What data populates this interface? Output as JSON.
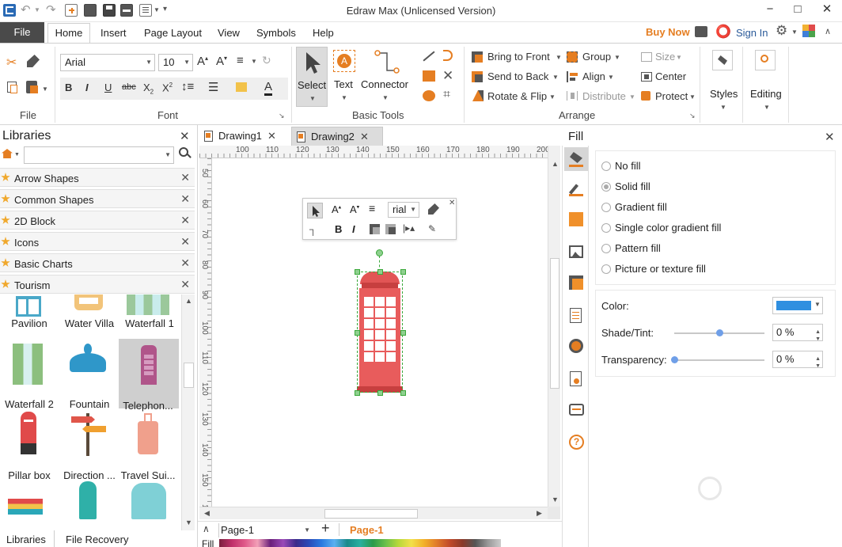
{
  "titlebar": {
    "title": "Edraw Max (Unlicensed Version)",
    "minimize": "−",
    "maximize": "□",
    "close": "✕"
  },
  "menu": {
    "file": "File",
    "tabs": [
      "Home",
      "Insert",
      "Page Layout",
      "View",
      "Symbols",
      "Help"
    ],
    "buy_now": "Buy Now",
    "sign_in": "Sign In"
  },
  "ribbon": {
    "file_group": "File",
    "font_group": "Font",
    "font_name": "Arial",
    "font_size": "10",
    "basic_tools_group": "Basic Tools",
    "select": "Select",
    "text": "Text",
    "connector": "Connector",
    "arrange_group": "Arrange",
    "bring_to_front": "Bring to Front",
    "send_to_back": "Send to Back",
    "rotate_flip": "Rotate & Flip",
    "group": "Group",
    "align": "Align",
    "distribute": "Distribute",
    "size": "Size",
    "center": "Center",
    "protect": "Protect",
    "styles": "Styles",
    "editing": "Editing"
  },
  "libraries": {
    "title": "Libraries",
    "search_placeholder": "",
    "categories": [
      "Arrow Shapes",
      "Common Shapes",
      "2D Block",
      "Icons",
      "Basic Charts",
      "Tourism"
    ],
    "shapes": [
      "Pavilion",
      "Water Villa",
      "Waterfall 1",
      "Waterfall 2",
      "Fountain",
      "Telephon...",
      "Pillar box",
      "Direction ...",
      "Travel Sui..."
    ],
    "bottom_tabs": [
      "Libraries",
      "File Recovery"
    ]
  },
  "documents": {
    "tabs": [
      "Drawing1",
      "Drawing2"
    ]
  },
  "ruler": {
    "top": [
      "100",
      "110",
      "120",
      "130",
      "140",
      "150",
      "160",
      "170",
      "180",
      "190",
      "200"
    ],
    "left": [
      "50",
      "60",
      "70",
      "80",
      "90",
      "100",
      "110",
      "120",
      "130",
      "140",
      "150",
      "160"
    ]
  },
  "floating_toolbar": {
    "font": "rial"
  },
  "statusbar": {
    "page_select": "Page-1",
    "page_tab": "Page-1",
    "fill_label": "Fill"
  },
  "fill_panel": {
    "title": "Fill",
    "options": [
      "No fill",
      "Solid fill",
      "Gradient fill",
      "Single color gradient fill",
      "Pattern fill",
      "Picture or texture fill"
    ],
    "selected_option": "Solid fill",
    "color_label": "Color:",
    "color_value": "#2f8fe0",
    "shade_label": "Shade/Tint:",
    "shade_value": "0 %",
    "shade_level": 0.5,
    "transparency_label": "Transparency:",
    "transparency_value": "0 %",
    "transparency_level": 0.0
  },
  "colors": {
    "accent": "#e57e22",
    "booth_red": "#e25555",
    "booth_dark": "#c73f3f",
    "selection_green": "#3aa83a"
  }
}
